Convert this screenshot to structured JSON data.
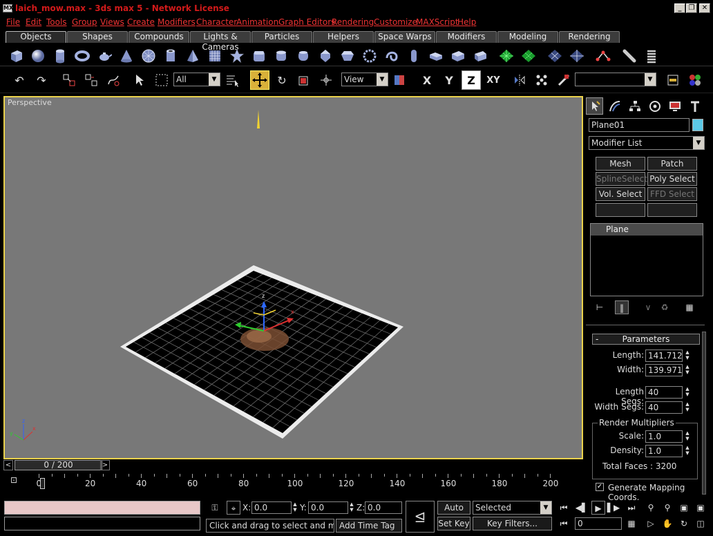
{
  "window": {
    "title": "laich_mow.max - 3ds max 5 - Network License",
    "app_icon": "MX",
    "controls": [
      "_",
      "❐",
      "✕"
    ]
  },
  "menu": [
    "File",
    "Edit",
    "Tools",
    "Group",
    "Views",
    "Create",
    "Modifiers",
    "Character",
    "Animation",
    "Graph Editors",
    "Rendering",
    "Customize",
    "MAXScript",
    "Help"
  ],
  "tabs": [
    "Objects",
    "Shapes",
    "Compounds",
    "Lights & Cameras",
    "Particles",
    "Helpers",
    "Space Warps",
    "Modifiers",
    "Modeling",
    "Rendering"
  ],
  "shape_icons": [
    "box-icon",
    "sphere-icon",
    "cylinder-icon",
    "torus-icon",
    "teapot-icon",
    "cone-icon",
    "geosphere-icon",
    "tube-icon",
    "pyramid-icon",
    "plane-icon",
    "hedra-icon",
    "chamfer-box-icon",
    "chamfer-cyl-icon",
    "oiltank-icon",
    "spindle-icon",
    "gengon-icon",
    "ringwave-icon",
    "torus-knot-icon",
    "capsule-icon",
    "l-ext-icon",
    "c-ext-icon",
    "prism-icon",
    "nurbs-surface-icon",
    "nurbs-surface-2-icon",
    "mesh-grid-icon",
    "mesh-grid-2-icon",
    "link-icon",
    "bone-icon",
    "spring-icon"
  ],
  "toolbar": {
    "selection_filter": "All",
    "ref_coord": "View",
    "named_selection": "",
    "axis_x": "X",
    "axis_y": "Y",
    "axis_z": "Z",
    "axis_xy": "XY"
  },
  "viewport": {
    "label": "Perspective",
    "axis_x": "x",
    "axis_y": "y",
    "axis_z": "z"
  },
  "command_panel": {
    "object_name": "Plane01",
    "object_color": "#5bc8e6",
    "modifier_list": "Modifier List",
    "modifier_buttons": [
      {
        "label": "Mesh Select",
        "enabled": true
      },
      {
        "label": "Patch Select",
        "enabled": true
      },
      {
        "label": "SplineSelect",
        "enabled": false
      },
      {
        "label": "Poly Select",
        "enabled": true
      },
      {
        "label": "Vol. Select",
        "enabled": true
      },
      {
        "label": "FFD Select",
        "enabled": false
      },
      {
        "label": "",
        "enabled": false
      },
      {
        "label": "",
        "enabled": false
      }
    ],
    "stack_item": "Plane",
    "rollout_toggle": "-",
    "rollout_title": "Parameters",
    "length_label": "Length:",
    "length_value": "141.712",
    "width_label": "Width:",
    "width_value": "139.971",
    "length_segs_label": "Length Segs:",
    "length_segs_value": "40",
    "width_segs_label": "Width Segs:",
    "width_segs_value": "40",
    "render_mult_label": "Render Multipliers",
    "scale_label": "Scale:",
    "scale_value": "1.0",
    "density_label": "Density:",
    "density_value": "1.0",
    "total_faces": "Total Faces : 3200",
    "gen_mapping_label": "Generate Mapping Coords.",
    "gen_mapping_checked": true
  },
  "timeline": {
    "frame_display": "0 / 200",
    "ticks": [
      "0",
      "20",
      "40",
      "60",
      "80",
      "100",
      "120",
      "140",
      "160",
      "180",
      "200"
    ]
  },
  "status": {
    "x_label": "X:",
    "x_value": "0.0",
    "y_label": "Y:",
    "y_value": "0.0",
    "z_label": "Z:",
    "z_value": "0.0",
    "prompt": "Click and drag to select and move obj",
    "add_time_tag": "Add Time Tag",
    "auto_key": "Auto Key",
    "set_key": "Set Key",
    "selected": "Selected",
    "key_filters": "Key Filters...",
    "current_frame": "0"
  }
}
